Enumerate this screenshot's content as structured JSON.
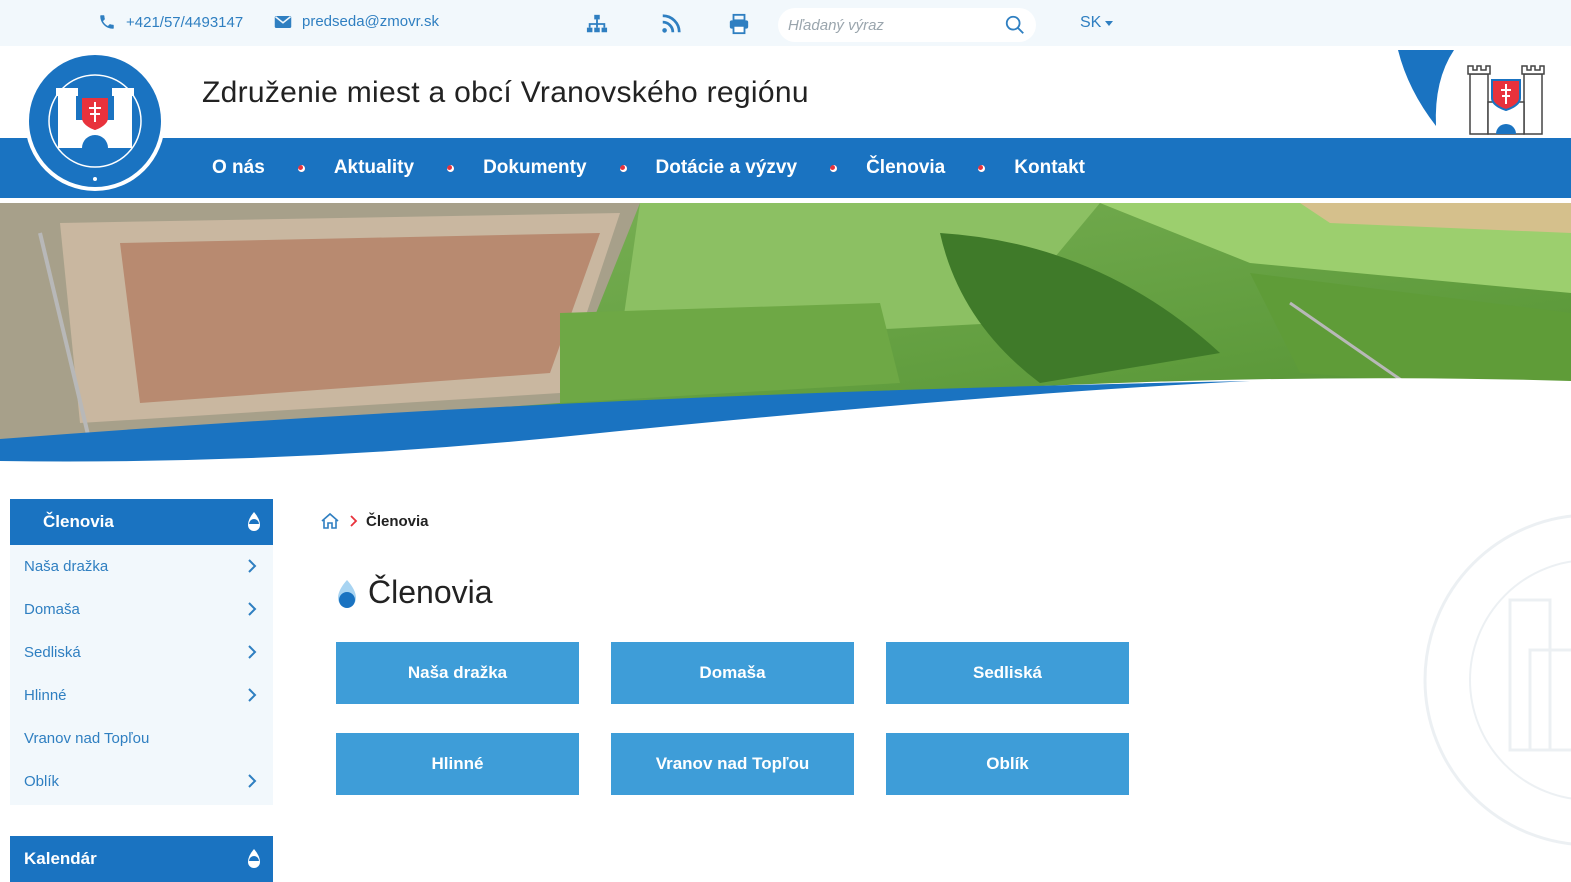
{
  "topbar": {
    "phone": "+421/57/4493147",
    "email": "predseda@zmovr.sk",
    "search_placeholder": "Hľadaný výraz",
    "lang": "SK"
  },
  "header": {
    "site_title": "Združenie miest a obcí Vranovského regiónu"
  },
  "nav": {
    "items": [
      "O nás",
      "Aktuality",
      "Dokumenty",
      "Dotácie a výzvy",
      "Členovia",
      "Kontakt"
    ]
  },
  "sidebar": {
    "section_title": "Členovia",
    "items": [
      {
        "label": "Naša dražka",
        "has_children": true
      },
      {
        "label": "Domaša",
        "has_children": true
      },
      {
        "label": "Sedliská",
        "has_children": true
      },
      {
        "label": "Hlinné",
        "has_children": true
      },
      {
        "label": "Vranov nad Topľou",
        "has_children": false
      },
      {
        "label": "Oblík",
        "has_children": true
      }
    ],
    "second_section_title": "Kalendár"
  },
  "breadcrumb": {
    "current": "Členovia"
  },
  "main": {
    "title": "Členovia",
    "tiles": [
      "Naša dražka",
      "Domaša",
      "Sedliská",
      "Hlinné",
      "Vranov nad Topľou",
      "Oblík"
    ]
  },
  "colors": {
    "primary": "#1a73c1",
    "tile": "#3e9dd8",
    "accent_red": "#e8323c",
    "topbar_bg": "#f2f8fc"
  }
}
